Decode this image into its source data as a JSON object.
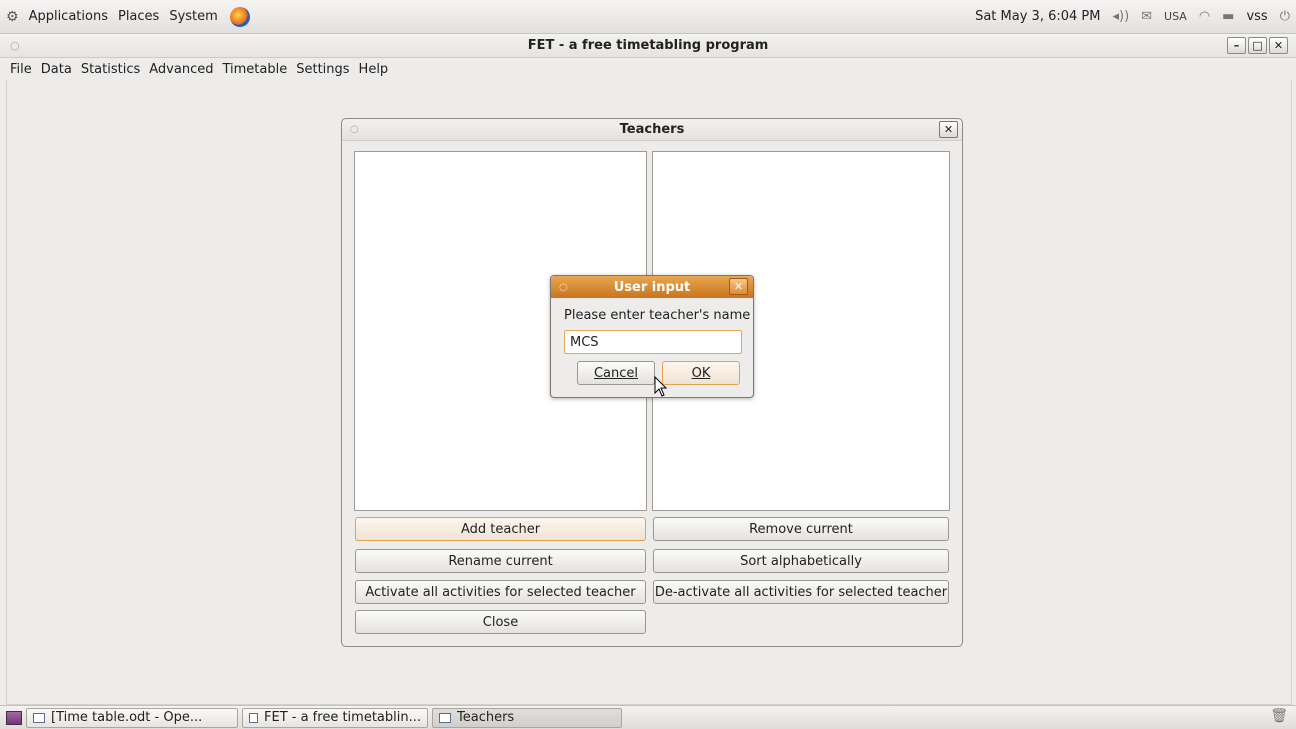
{
  "top_panel": {
    "menus": [
      "Applications",
      "Places",
      "System"
    ],
    "datetime": "Sat May 3, 6:04 PM",
    "keyboard": "USA",
    "user": "vss"
  },
  "window": {
    "title": "FET - a free timetabling program",
    "menubar": [
      "File",
      "Data",
      "Statistics",
      "Advanced",
      "Timetable",
      "Settings",
      "Help"
    ]
  },
  "teachers_dialog": {
    "title": "Teachers",
    "buttons": {
      "add": "Add teacher",
      "remove": "Remove current",
      "rename": "Rename current",
      "sort": "Sort alphabetically",
      "activate": "Activate all activities for selected teacher",
      "deactivate": "De-activate all activities for selected teacher",
      "close": "Close"
    }
  },
  "user_input_dialog": {
    "title": "User input",
    "prompt": "Please enter teacher's name",
    "value": "MCS",
    "cancel_label": "Cancel",
    "ok_label": "OK"
  },
  "taskbar": {
    "tasks": [
      "[Time table.odt - Ope...",
      "FET - a free timetablin...",
      "Teachers"
    ]
  }
}
